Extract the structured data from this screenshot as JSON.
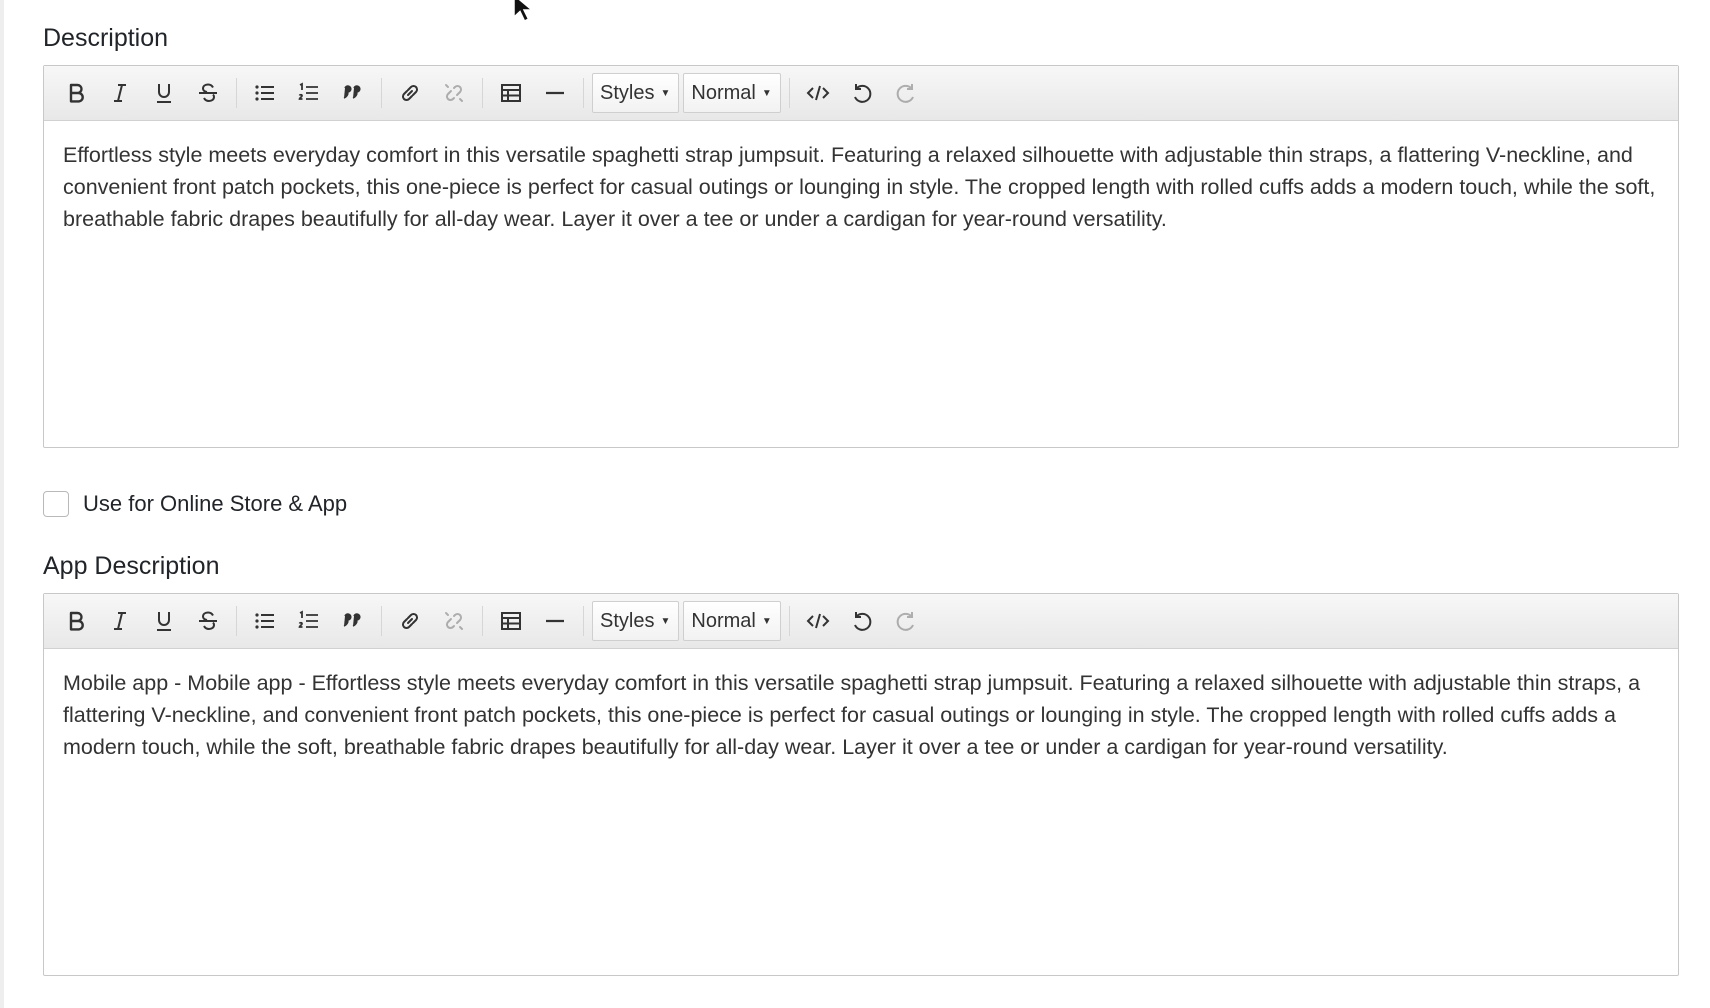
{
  "description_section": {
    "title": "Description",
    "toolbar": {
      "styles_label": "Styles",
      "format_label": "Normal"
    },
    "content": "Effortless style meets everyday comfort in this versatile spaghetti strap jumpsuit. Featuring a relaxed silhouette with adjustable thin straps, a flattering V-neckline, and convenient front patch pockets, this one-piece is perfect for casual outings or lounging in style. The cropped length with rolled cuffs adds a modern touch, while the soft, breathable fabric drapes beautifully for all-day wear. Layer it over a tee or under a cardigan for year-round versatility."
  },
  "online_store_checkbox": {
    "label": "Use for Online Store & App",
    "checked": false
  },
  "app_description_section": {
    "title": "App Description",
    "toolbar": {
      "styles_label": "Styles",
      "format_label": "Normal"
    },
    "content": "Mobile app - Mobile app - Effortless style meets everyday comfort in this versatile spaghetti strap jumpsuit. Featuring a relaxed silhouette with adjustable thin straps, a flattering V-neckline, and convenient front patch pockets, this one-piece is perfect for casual outings or lounging in style. The cropped length with rolled cuffs adds a modern touch, while the soft, breathable fabric drapes beautifully for all-day wear. Layer it over a tee or under a cardigan for year-round versatility."
  },
  "toolbar_icons": [
    "bold-icon",
    "italic-icon",
    "underline-icon",
    "strikethrough-icon",
    "bulleted-list-icon",
    "numbered-list-icon",
    "blockquote-icon",
    "link-icon",
    "unlink-icon",
    "table-icon",
    "horizontal-rule-icon",
    "source-code-icon",
    "undo-icon",
    "redo-icon"
  ]
}
